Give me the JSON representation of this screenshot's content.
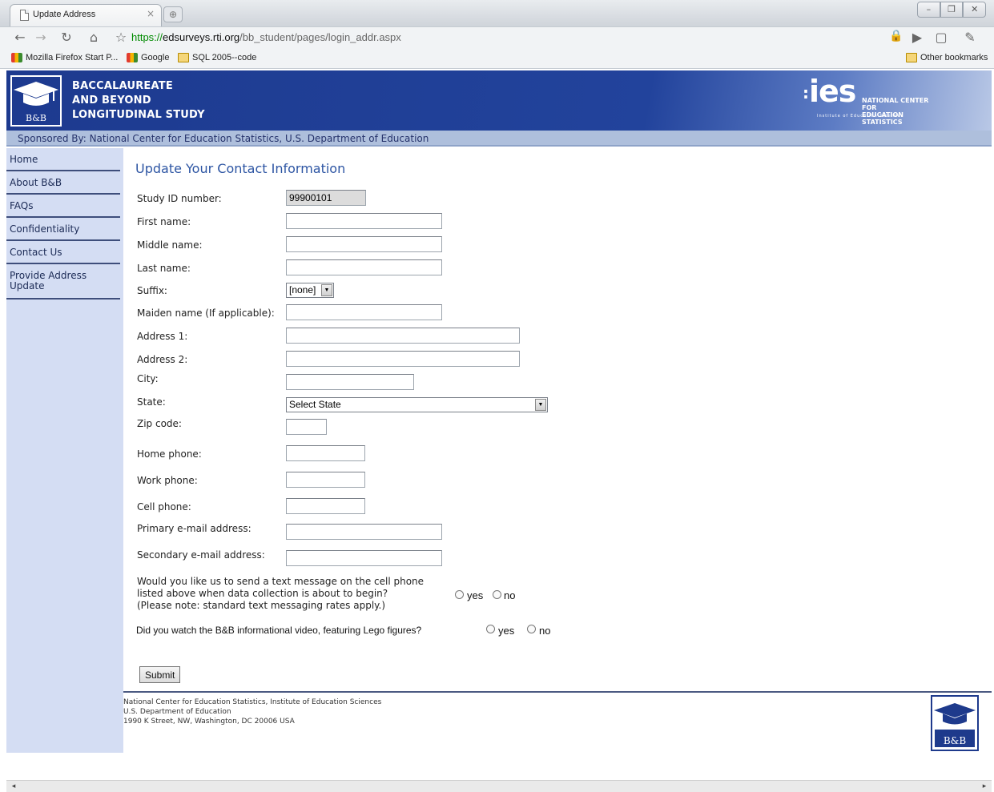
{
  "browser": {
    "tab_title": "Update Address",
    "tab_close": "×",
    "new_tab": "⊕",
    "window_controls": [
      "–",
      "❐",
      "✕"
    ],
    "url_scheme": "https://",
    "url_host": "edsurveys.rti.org",
    "url_path": "/bb_student/pages/login_addr.aspx",
    "nav_icons": [
      "back-icon",
      "forward-icon",
      "reload-icon",
      "home-icon",
      "star-icon"
    ],
    "bookmarks": [
      "Mozilla Firefox Start P...",
      "Google",
      "SQL 2005--code"
    ],
    "other_bookmarks": "Other bookmarks"
  },
  "header": {
    "logo_text": "B&B",
    "title_lines": [
      "BACCALAUREATE",
      "AND BEYOND",
      "LONGITUDINAL STUDY"
    ],
    "ies_text": "ies",
    "ies_org": [
      "NATIONAL CENTER FOR",
      "EDUCATION STATISTICS"
    ],
    "ies_tagline": "Institute of Education Sciences",
    "sponsor": "Sponsored By: National Center for Education Statistics, U.S. Department of Education"
  },
  "sidebar": {
    "items": [
      "Home",
      "About B&B",
      "FAQs",
      "Confidentiality",
      "Contact Us",
      "Provide Address Update"
    ]
  },
  "form": {
    "title": "Update Your Contact Information",
    "study_id_label": "Study ID number:",
    "study_id_value": "99900101",
    "first_name_label": "First name:",
    "middle_name_label": "Middle name:",
    "last_name_label": "Last name:",
    "suffix_label": "Suffix:",
    "suffix_value": "[none]",
    "maiden_label": "Maiden name (If applicable):",
    "address1_label": "Address 1:",
    "address2_label": "Address 2:",
    "city_label": "City:",
    "state_label": "State:",
    "state_value": "Select State",
    "zip_label": "Zip code:",
    "home_phone_label": "Home phone:",
    "work_phone_label": "Work phone:",
    "cell_phone_label": "Cell phone:",
    "primary_email_label": "Primary e-mail address:",
    "secondary_email_label": "Secondary e-mail address:",
    "text_question": [
      "Would you like us to send a text message on the cell phone",
      "listed above when data collection is about to begin?",
      "(Please note: standard text messaging rates apply.)"
    ],
    "video_question": "Did you watch the B&B informational  video, featuring Lego figures?",
    "yes_label": "yes",
    "no_label": "no",
    "submit_label": "Submit"
  },
  "footer": {
    "lines": [
      "National Center for Education Statistics, Institute of Education Sciences",
      "U.S. Department of Education",
      "1990 K Street, NW, Washington, DC 20006 USA"
    ],
    "logo_text": "B&B"
  },
  "scroll": {
    "left_arrow": "◂",
    "right_arrow": "▸"
  }
}
